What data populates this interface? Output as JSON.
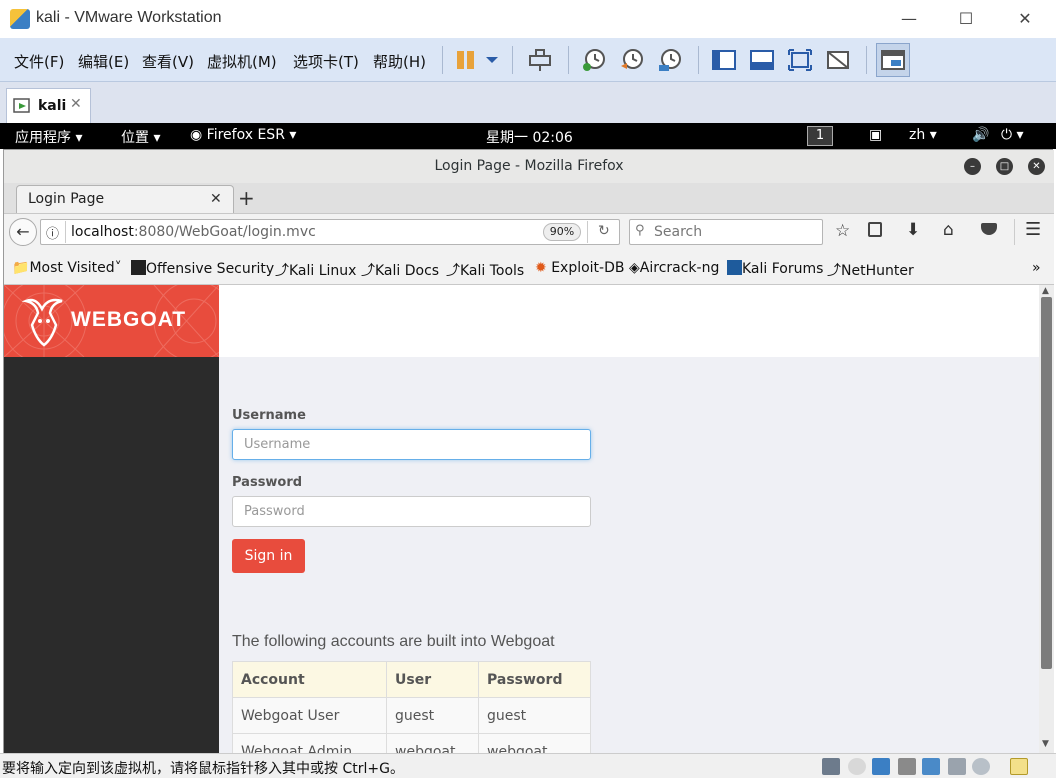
{
  "vmware": {
    "title": "kali - VMware Workstation",
    "menu": [
      "文件(F)",
      "编辑(E)",
      "查看(V)",
      "虚拟机(M)",
      "选项卡(T)",
      "帮助(H)"
    ],
    "tab_label": "kali",
    "status_text": "要将输入定向到该虚拟机，请将鼠标指针移入其中或按 Ctrl+G。"
  },
  "kali_panel": {
    "apps": "应用程序",
    "places": "位置",
    "firefox": "Firefox ESR",
    "clock": "星期一 02:06",
    "workspace": "1",
    "lang": "zh"
  },
  "firefox": {
    "window_title": "Login Page - Mozilla Firefox",
    "tab_title": "Login Page",
    "url_host": "localhost",
    "url_rest": ":8080/WebGoat/login.mvc",
    "zoom": "90%",
    "search_placeholder": "Search",
    "bookmarks": [
      "Most Visited",
      "Offensive Security",
      "Kali Linux",
      "Kali Docs",
      "Kali Tools",
      "Exploit-DB",
      "Aircrack-ng",
      "Kali Forums",
      "NetHunter"
    ]
  },
  "page": {
    "logo_text": "WEBGOAT",
    "username_label": "Username",
    "username_placeholder": "Username",
    "password_label": "Password",
    "password_placeholder": "Password",
    "signin_label": "Sign in",
    "accounts_intro": "The following accounts are built into Webgoat",
    "table_headers": [
      "Account",
      "User",
      "Password"
    ],
    "table_rows": [
      [
        "Webgoat User",
        "guest",
        "guest"
      ],
      [
        "Webgoat Admin",
        "webgoat",
        "webgoat"
      ]
    ]
  }
}
